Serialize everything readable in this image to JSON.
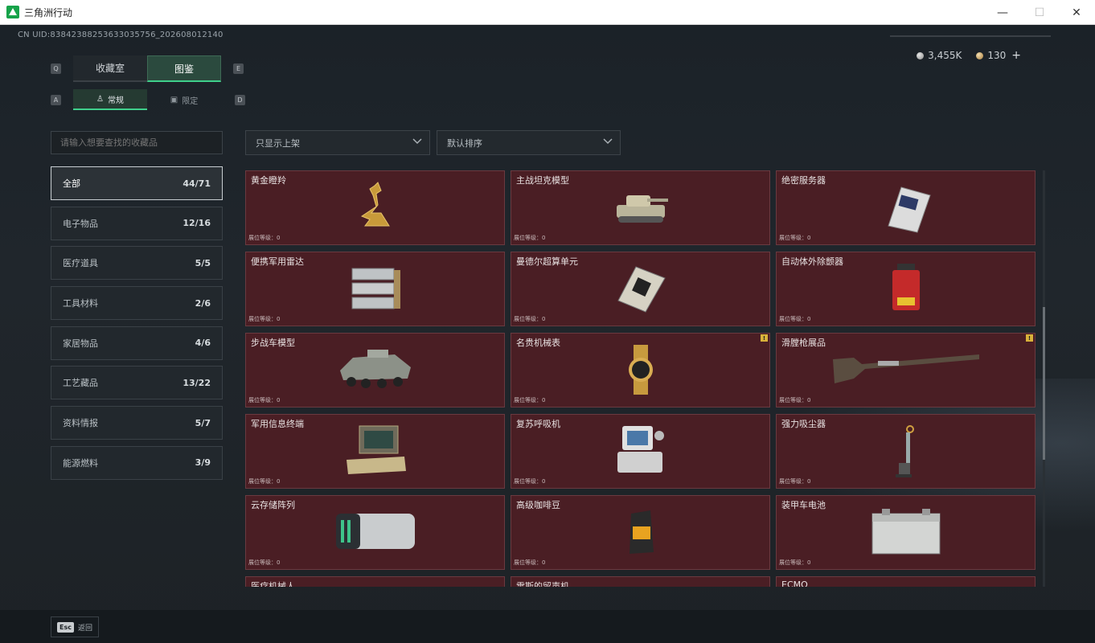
{
  "window": {
    "title": "三角洲行动",
    "minimize": "—",
    "maximize": "☐",
    "close": "✕"
  },
  "header": {
    "uid": "CN UID:83842388253633035756_202608012140"
  },
  "currency": [
    {
      "name": "silver-coin",
      "value": "3,455K"
    },
    {
      "name": "gold-coin",
      "value": "130"
    }
  ],
  "currency_plus": "+",
  "keys": {
    "prev_tab": "Q",
    "next_tab": "E",
    "prev_sub": "A",
    "next_sub": "D"
  },
  "tabs": [
    {
      "label": "收藏室"
    },
    {
      "label": "图鉴"
    }
  ],
  "subtabs": [
    {
      "label": "常规"
    },
    {
      "label": "限定"
    }
  ],
  "search": {
    "placeholder": "请输入想要查找的收藏品"
  },
  "filters": {
    "show": "只显示上架",
    "sort": "默认排序"
  },
  "categories": [
    {
      "label": "全部",
      "count": "44/71"
    },
    {
      "label": "电子物品",
      "count": "12/16"
    },
    {
      "label": "医疗道具",
      "count": "5/5"
    },
    {
      "label": "工具材料",
      "count": "2/6"
    },
    {
      "label": "家居物品",
      "count": "4/6"
    },
    {
      "label": "工艺藏品",
      "count": "13/22"
    },
    {
      "label": "资料情报",
      "count": "5/7"
    },
    {
      "label": "能源燃料",
      "count": "3/9"
    }
  ],
  "items": [
    {
      "name": "黄金瞪羚",
      "level": "展位等级：0",
      "icon": "golden-gazelle"
    },
    {
      "name": "主战坦克模型",
      "level": "展位等级：0",
      "icon": "tank-model"
    },
    {
      "name": "绝密服务器",
      "level": "展位等级：0",
      "icon": "server"
    },
    {
      "name": "便携军用雷达",
      "level": "展位等级：0",
      "icon": "radar"
    },
    {
      "name": "曼德尔超算单元",
      "level": "展位等级：0",
      "icon": "compute-unit"
    },
    {
      "name": "自动体外除颤器",
      "level": "展位等级：0",
      "icon": "defibrillator"
    },
    {
      "name": "步战车模型",
      "level": "展位等级：0",
      "icon": "ifv-model"
    },
    {
      "name": "名贵机械表",
      "level": "展位等级：0",
      "icon": "watch",
      "badge": "!"
    },
    {
      "name": "滑膛枪展品",
      "level": "展位等级：0",
      "icon": "musket",
      "badge": "!"
    },
    {
      "name": "军用信息终端",
      "level": "展位等级：0",
      "icon": "terminal"
    },
    {
      "name": "复苏呼吸机",
      "level": "展位等级：0",
      "icon": "ventilator"
    },
    {
      "name": "强力吸尘器",
      "level": "展位等级：0",
      "icon": "vacuum"
    },
    {
      "name": "云存储阵列",
      "level": "展位等级：0",
      "icon": "storage-array"
    },
    {
      "name": "高级咖啡豆",
      "level": "展位等级：0",
      "icon": "coffee-bag"
    },
    {
      "name": "装甲车电池",
      "level": "展位等级：0",
      "icon": "battery"
    },
    {
      "name": "医疗机械人",
      "level": "",
      "icon": ""
    },
    {
      "name": "雷斯的留声机",
      "level": "",
      "icon": ""
    },
    {
      "name": "ECMO",
      "level": "",
      "icon": ""
    }
  ],
  "footer": {
    "esc": "Esc",
    "back": "返回"
  }
}
